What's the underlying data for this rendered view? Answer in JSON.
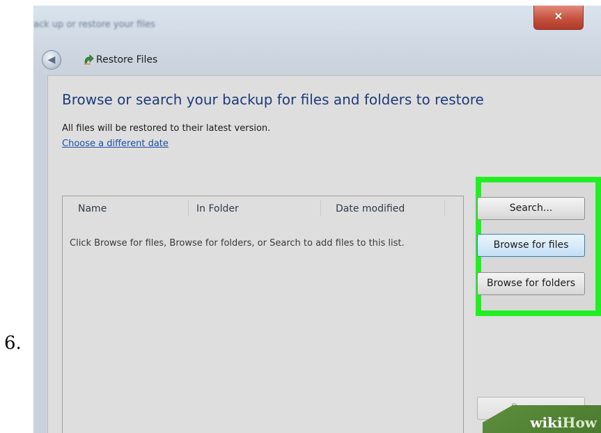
{
  "step_number": "6.",
  "window": {
    "title": "ack up or restore your files",
    "close_glyph": "×"
  },
  "nav": {
    "back_icon": "back-arrow-icon",
    "title": "Restore Files"
  },
  "main": {
    "heading": "Browse or search your backup for files and folders to restore",
    "subtext": "All files will be restored to their latest version.",
    "link": "Choose a different date"
  },
  "list": {
    "columns": [
      "Name",
      "In Folder",
      "Date modified"
    ],
    "empty_message": "Click Browse for files, Browse for folders, or Search to add files to this list."
  },
  "buttons": {
    "search": "Search...",
    "browse_files": "Browse for files",
    "browse_folders": "Browse for folders",
    "remove": "Remove"
  },
  "watermark": {
    "part1": "wiki",
    "part2": "How"
  },
  "colors": {
    "highlight": "#22ef22",
    "heading": "#1e3b78",
    "link": "#1a4fa5"
  }
}
